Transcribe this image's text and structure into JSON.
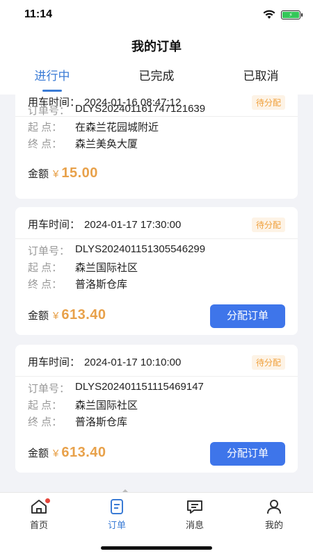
{
  "status_bar": {
    "time": "11:14"
  },
  "header": {
    "title": "我的订单"
  },
  "tabs": [
    {
      "label": "进行中"
    },
    {
      "label": "已完成"
    },
    {
      "label": "已取消"
    }
  ],
  "orders": [
    {
      "time_label": "用车时间：",
      "time": "2024-01-16 08:47:12",
      "status": "待分配",
      "order_no_label": "订单号：",
      "order_no": "DLYS202401161747121639",
      "start_label": "起    点：",
      "start": "在森兰花园城附近",
      "end_label": "终    点：",
      "end": "森兰美奂大厦",
      "amount_label": "金额",
      "currency": "¥",
      "amount": "15.00"
    },
    {
      "time_label": "用车时间：",
      "time": "2024-01-17 17:30:00",
      "status": "待分配",
      "order_no_label": "订单号：",
      "order_no": "DLYS202401151305546299",
      "start_label": "起    点：",
      "start": "森兰国际社区",
      "end_label": "终    点：",
      "end": "普洛斯仓库",
      "amount_label": "金额",
      "currency": "¥",
      "amount": "613.40",
      "button": "分配订单"
    },
    {
      "time_label": "用车时间：",
      "time": "2024-01-17 10:10:00",
      "status": "待分配",
      "order_no_label": "订单号：",
      "order_no": "DLYS202401151115469147",
      "start_label": "起    点：",
      "start": "森兰国际社区",
      "end_label": "终    点：",
      "end": "普洛斯仓库",
      "amount_label": "金额",
      "currency": "¥",
      "amount": "613.40",
      "button": "分配订单"
    }
  ],
  "tabbar": [
    {
      "label": "首页",
      "icon": "home-icon",
      "badge": true
    },
    {
      "label": "订单",
      "icon": "order-icon",
      "active": true
    },
    {
      "label": "消息",
      "icon": "message-icon"
    },
    {
      "label": "我的",
      "icon": "user-icon"
    }
  ],
  "colors": {
    "accent": "#3a7bd5",
    "button": "#3e75ea",
    "amount": "#e8a14a",
    "badge": "#e5463c"
  }
}
